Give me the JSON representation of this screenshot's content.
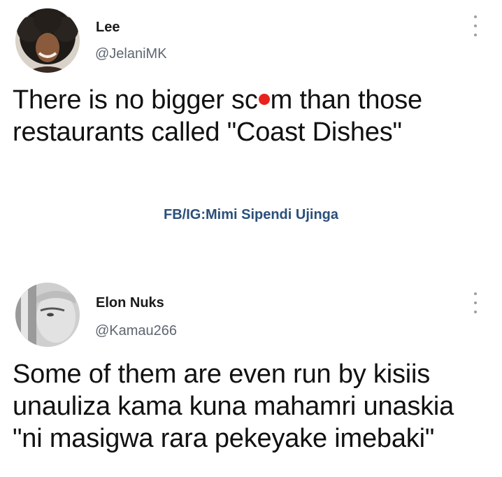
{
  "tweets": [
    {
      "name": "Lee",
      "handle": "@JelaniMK",
      "text_before": "There is no bigger sc",
      "text_after": "m than those\nrestaurants called \"Coast Dishes\""
    },
    {
      "name": "Elon Nuks",
      "handle": "@Kamau266",
      "text": "Some of them are even run by kisiis\nunauliza kama kuna mahamri unaskia\n\"ni masigwa rara pekeyake imebaki\""
    }
  ],
  "watermark": "FB/IG:Mimi Sipendi Ujinga",
  "colors": {
    "text": "#111111",
    "handle": "#5f6670",
    "watermark": "#2b4f7a",
    "censor_dot": "#e8231d"
  },
  "icons": {
    "more": "vertical-ellipsis-icon",
    "censor": "red-dot-icon"
  }
}
